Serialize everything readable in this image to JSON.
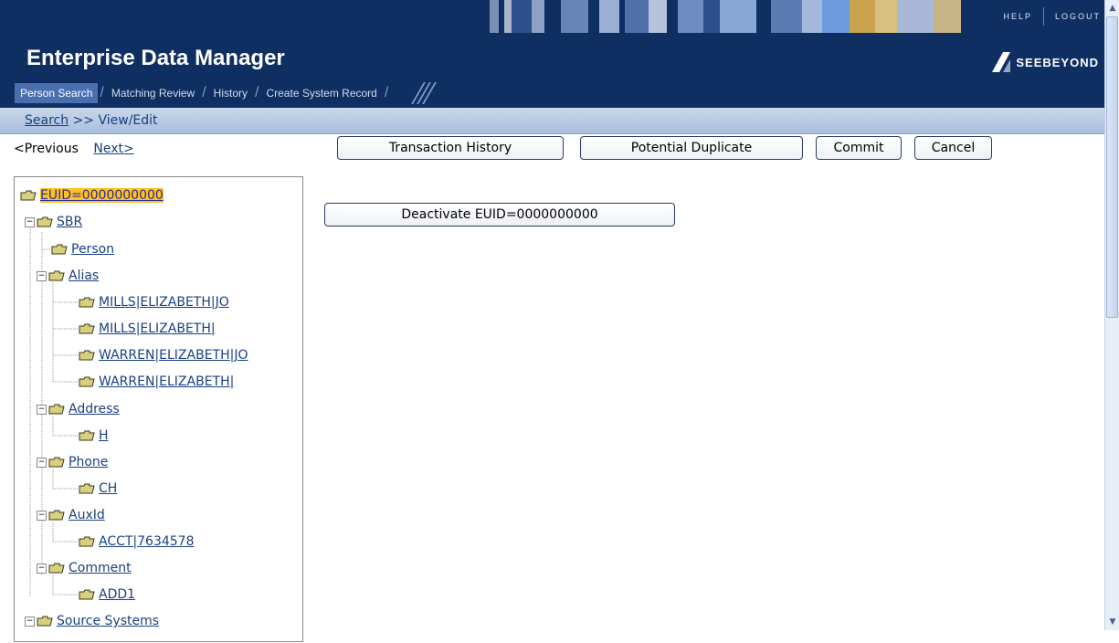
{
  "header": {
    "help_label": "HELP",
    "logout_label": "LOGOUT",
    "app_title": "Enterprise Data Manager",
    "brand": "SEEBEYOND",
    "brand_color": "#0f2f63"
  },
  "tabs": [
    {
      "label": "Person Search",
      "active": true
    },
    {
      "label": "Matching Review",
      "active": false
    },
    {
      "label": "History",
      "active": false
    },
    {
      "label": "Create System Record",
      "active": false
    }
  ],
  "breadcrumb": {
    "link": "Search",
    "separator": ">>",
    "current": "View/Edit"
  },
  "pager": {
    "previous": "<Previous",
    "next": "Next>"
  },
  "toolbar": {
    "transaction_history": "Transaction History",
    "potential_duplicate": "Potential Duplicate",
    "commit": "Commit",
    "cancel": "Cancel"
  },
  "deactivate_button": "Deactivate EUID=0000000000",
  "tree": {
    "root": "EUID=0000000000",
    "sbr": "SBR",
    "person": "Person",
    "alias": "Alias",
    "alias_items": [
      "MILLS|ELIZABETH|JO",
      "MILLS|ELIZABETH|",
      "WARREN|ELIZABETH|JO",
      "WARREN|ELIZABETH|"
    ],
    "address": "Address",
    "address_items": [
      "H"
    ],
    "phone": "Phone",
    "phone_items": [
      "CH"
    ],
    "auxid": "AuxId",
    "auxid_items": [
      "ACCT|7634578"
    ],
    "comment": "Comment",
    "comment_items": [
      "ADD1"
    ],
    "source_systems": "Source Systems"
  },
  "icons": {
    "folder": "folder-icon",
    "toggle": "minus-toggle-icon"
  }
}
